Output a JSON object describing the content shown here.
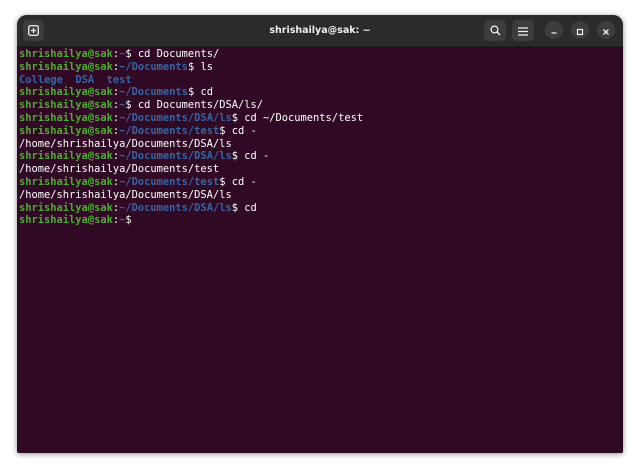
{
  "window": {
    "title": "shrishailya@sak: ~"
  },
  "colors": {
    "background": "#300a24",
    "user": "#4ead2f",
    "path": "#3465a4",
    "text": "#ffffff"
  },
  "icons": {
    "new_tab": "new-tab-icon",
    "search": "search-icon",
    "menu": "hamburger-menu-icon",
    "minimize": "minimize-icon",
    "maximize": "maximize-icon",
    "close": "close-icon"
  },
  "terminal": {
    "lines": [
      {
        "type": "prompt",
        "user": "shrishailya@sak",
        "path": "~",
        "command": "cd Documents/"
      },
      {
        "type": "prompt",
        "user": "shrishailya@sak",
        "path": "~/Documents",
        "command": "ls"
      },
      {
        "type": "dirs",
        "items": [
          "College",
          "DSA",
          "test"
        ]
      },
      {
        "type": "prompt",
        "user": "shrishailya@sak",
        "path": "~/Documents",
        "command": "cd"
      },
      {
        "type": "prompt",
        "user": "shrishailya@sak",
        "path": "~",
        "command": "cd Documents/DSA/ls/"
      },
      {
        "type": "prompt",
        "user": "shrishailya@sak",
        "path": "~/Documents/DSA/ls",
        "command": "cd ~/Documents/test"
      },
      {
        "type": "prompt",
        "user": "shrishailya@sak",
        "path": "~/Documents/test",
        "command": "cd -"
      },
      {
        "type": "output",
        "text": "/home/shrishailya/Documents/DSA/ls"
      },
      {
        "type": "prompt",
        "user": "shrishailya@sak",
        "path": "~/Documents/DSA/ls",
        "command": "cd -"
      },
      {
        "type": "output",
        "text": "/home/shrishailya/Documents/test"
      },
      {
        "type": "prompt",
        "user": "shrishailya@sak",
        "path": "~/Documents/test",
        "command": "cd -"
      },
      {
        "type": "output",
        "text": "/home/shrishailya/Documents/DSA/ls"
      },
      {
        "type": "prompt",
        "user": "shrishailya@sak",
        "path": "~/Documents/DSA/ls",
        "command": "cd"
      },
      {
        "type": "prompt",
        "user": "shrishailya@sak",
        "path": "~",
        "command": ""
      }
    ]
  }
}
